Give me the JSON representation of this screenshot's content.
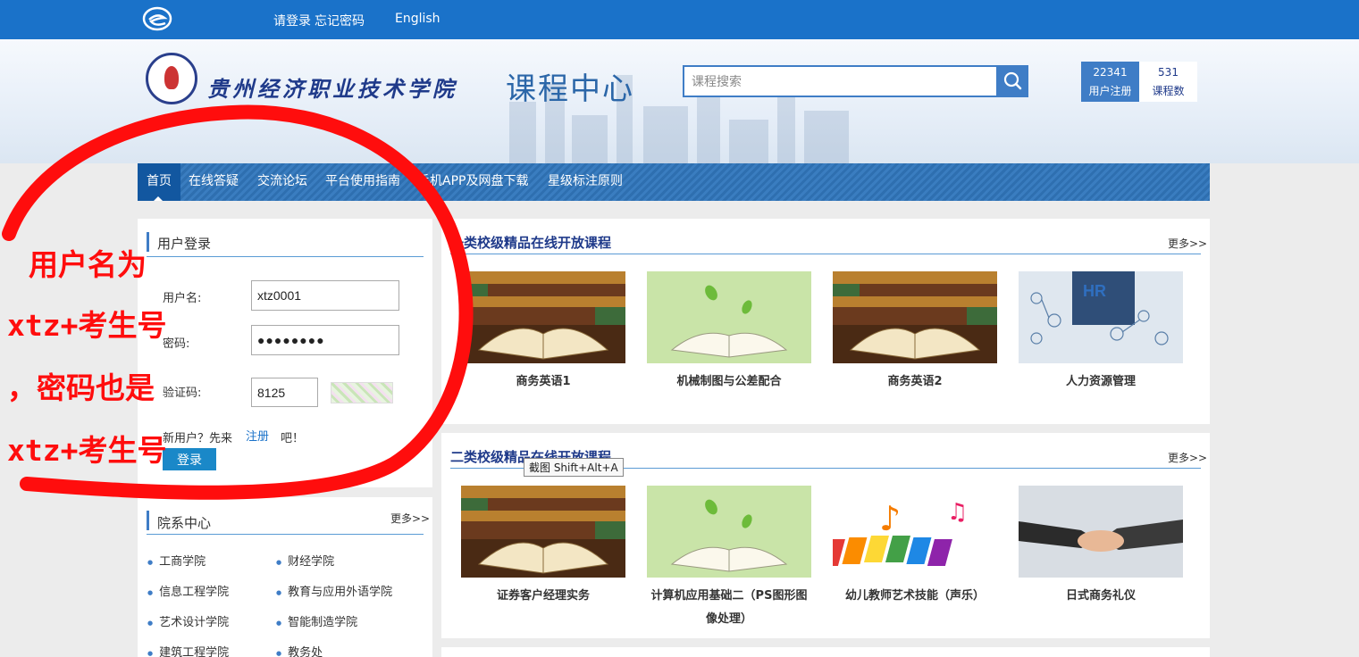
{
  "topbar": {
    "links": [
      "请登录",
      "忘记密码",
      "English"
    ]
  },
  "banner": {
    "school_name": "贵州经济职业技术学院",
    "center_title": "课程中心",
    "search": {
      "placeholder": "课程搜索",
      "value": ""
    },
    "stats": [
      {
        "value": "22341",
        "label": "用户注册"
      },
      {
        "value": "531",
        "label": "课程数"
      }
    ]
  },
  "nav": {
    "items": [
      "首页",
      "在线答疑",
      "交流论坛",
      "平台使用指南",
      "手机APP及网盘下载",
      "星级标注原则"
    ],
    "active_index": 0
  },
  "login": {
    "title": "用户登录",
    "username_label": "用户名:",
    "username_value": "xtz0001",
    "password_label": "密码:",
    "password_value": "●●●●●●●●",
    "captcha_label": "验证码:",
    "captcha_value": "8125",
    "register_prefix": "新用户？先来",
    "register_link": "注册",
    "register_suffix": "吧！",
    "login_button": "登录"
  },
  "departments": {
    "title": "院系中心",
    "more": "更多>>",
    "items": [
      "工商学院",
      "财经学院",
      "信息工程学院",
      "教育与应用外语学院",
      "艺术设计学院",
      "智能制造学院",
      "建筑工程学院",
      "教务处"
    ]
  },
  "sections": [
    {
      "title": "一类校级精品在线开放课程",
      "more": "更多>>",
      "courses": [
        {
          "name": "商务英语1",
          "image": "books-icon"
        },
        {
          "name": "机械制图与公差配合",
          "image": "open-book-sprout-icon"
        },
        {
          "name": "商务英语2",
          "image": "books-icon"
        },
        {
          "name": "人力资源管理",
          "image": "hr-network-icon"
        }
      ]
    },
    {
      "title": "二类校级精品在线开放课程",
      "more": "更多>>",
      "courses": [
        {
          "name": "证券客户经理实务",
          "image": "books-icon"
        },
        {
          "name": "计算机应用基础二（PS图形图像处理）",
          "image": "open-book-sprout-icon"
        },
        {
          "name": "幼儿教师艺术技能（声乐）",
          "image": "music-keyboard-icon"
        },
        {
          "name": "日式商务礼仪",
          "image": "handshake-icon"
        }
      ]
    }
  ],
  "tooltip": "截图 Shift+Alt+A",
  "annotation": {
    "lines": [
      "用户名为",
      "xtz+考生号",
      "，密码也是",
      "xtz+考生号"
    ],
    "color": "#ff0d0d"
  },
  "colors": {
    "topbar": "#1a72c9",
    "accent": "#3f7dc6",
    "title": "#1f3a8a"
  }
}
